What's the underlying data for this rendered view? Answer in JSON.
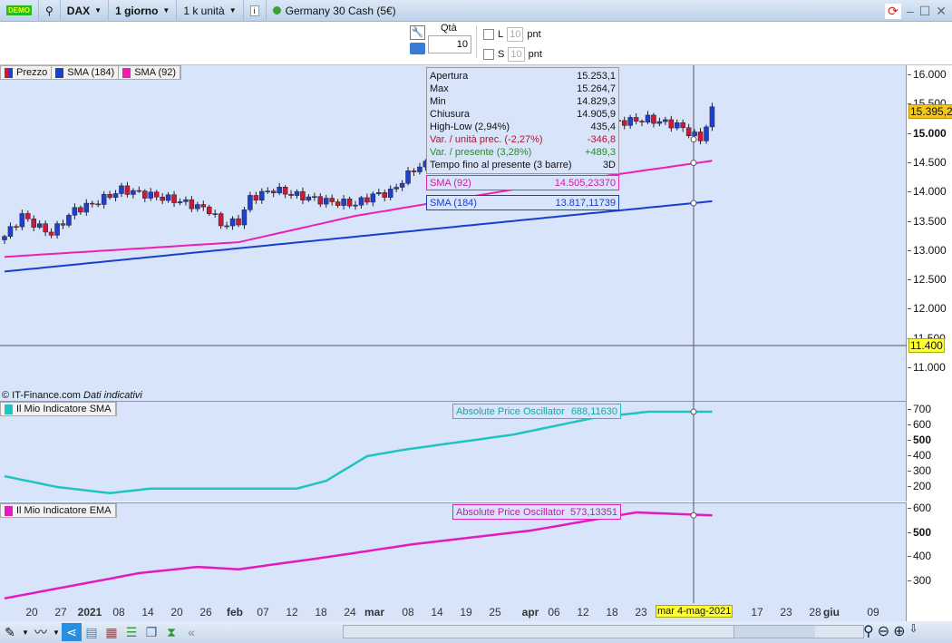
{
  "topbar": {
    "demo_badge": "DEMO",
    "instrument": "DAX",
    "timeframe": "1 giorno",
    "units": "1 k unità",
    "market_name": "Germany 30 Cash (5€)"
  },
  "order": {
    "qty_label": "Qtà",
    "qty_value": "10",
    "long_label": "L",
    "long_value": "10",
    "short_label": "S",
    "short_value": "10",
    "pnt": "pnt"
  },
  "legend": {
    "price": "Prezzo",
    "sma184": "SMA (184)",
    "sma92": "SMA (92)"
  },
  "tooltip": [
    {
      "label": "Apertura",
      "value": "15.253,1",
      "tone": "n"
    },
    {
      "label": "Max",
      "value": "15.264,7",
      "tone": "n"
    },
    {
      "label": "Min",
      "value": "14.829,3",
      "tone": "n"
    },
    {
      "label": "Chiusura",
      "value": "14.905,9",
      "tone": "n"
    },
    {
      "label": "High-Low (2,94%)",
      "value": "435,4",
      "tone": "n"
    },
    {
      "label": "Var. / unità prec. (-2,27%)",
      "value": "-346,8",
      "tone": "red"
    },
    {
      "label": "Var. / presente (3,28%)",
      "value": "+489,3",
      "tone": "green"
    },
    {
      "label": "Tempo fino al presente (3 barre)",
      "value": "3D",
      "tone": "n"
    }
  ],
  "sma92_box": {
    "label": "SMA (92)",
    "value": "14.505,23370"
  },
  "sma184_box": {
    "label": "SMA (184)",
    "value": "13.817,11739"
  },
  "price_axis": {
    "ticks": [
      "16.000",
      "15.500",
      "15.000",
      "14.500",
      "14.000",
      "13.500",
      "13.000",
      "12.500",
      "12.000",
      "11.500",
      "11.000"
    ],
    "last_price": "15.395,2",
    "cursor_price": "11.400"
  },
  "copyright": "© IT-Finance.com",
  "indicative": "Dati indicativi",
  "panel_sma": {
    "legend": "Il Mio Indicatore SMA",
    "box_label": "Absolute Price Oscillator",
    "box_value": "688,11630",
    "ticks": [
      "700",
      "600",
      "500",
      "400",
      "300",
      "200"
    ]
  },
  "panel_ema": {
    "legend": "Il Mio Indicatore EMA",
    "box_label": "Absolute Price Oscillator",
    "box_value": "573,13351",
    "ticks": [
      "600",
      "500",
      "400",
      "300"
    ]
  },
  "xaxis": {
    "labels": [
      "20",
      "27",
      "2021",
      "08",
      "14",
      "20",
      "26",
      "feb",
      "07",
      "12",
      "18",
      "24",
      "mar",
      "08",
      "14",
      "19",
      "25",
      "apr",
      "06",
      "12",
      "18",
      "23",
      "17",
      "23",
      "28",
      "giu",
      "09"
    ],
    "cursor_date": "mar 4-mag-2021"
  },
  "colors": {
    "up": "#1f3fcf",
    "down": "#d0163a",
    "sma184": "#1a3fcc",
    "sma92": "#ee1fb0",
    "osc_sma": "#1fc4c0",
    "osc_ema": "#e21ac0"
  },
  "chart_data": {
    "type": "candlestick",
    "close_keypoints": [
      [
        0,
        13250
      ],
      [
        3,
        13600
      ],
      [
        6,
        13400
      ],
      [
        8,
        13300
      ],
      [
        12,
        13700
      ],
      [
        15,
        13800
      ],
      [
        20,
        14050
      ],
      [
        25,
        13950
      ],
      [
        30,
        13850
      ],
      [
        35,
        13700
      ],
      [
        37,
        13450
      ],
      [
        40,
        13500
      ],
      [
        42,
        13900
      ],
      [
        46,
        14050
      ],
      [
        50,
        13950
      ],
      [
        55,
        13850
      ],
      [
        60,
        13800
      ],
      [
        63,
        13950
      ],
      [
        66,
        14000
      ],
      [
        70,
        14400
      ],
      [
        75,
        14600
      ],
      [
        80,
        14800
      ],
      [
        88,
        15150
      ],
      [
        95,
        15200
      ],
      [
        105,
        15200
      ],
      [
        110,
        15250
      ],
      [
        115,
        15150
      ],
      [
        119,
        14906
      ],
      [
        120,
        15150
      ],
      [
        121,
        15395
      ]
    ],
    "sma184": [
      [
        0,
        12650
      ],
      [
        121,
        13850
      ]
    ],
    "sma92": [
      [
        0,
        12900
      ],
      [
        40,
        13150
      ],
      [
        60,
        13600
      ],
      [
        90,
        14100
      ],
      [
        121,
        14540
      ]
    ],
    "osc_sma": [
      [
        0,
        270
      ],
      [
        9,
        200
      ],
      [
        18,
        160
      ],
      [
        25,
        190
      ],
      [
        50,
        190
      ],
      [
        55,
        240
      ],
      [
        62,
        400
      ],
      [
        68,
        440
      ],
      [
        87,
        540
      ],
      [
        101,
        650
      ],
      [
        110,
        688
      ],
      [
        121,
        688
      ]
    ],
    "osc_ema": [
      [
        0,
        230
      ],
      [
        23,
        334
      ],
      [
        33,
        360
      ],
      [
        40,
        350
      ],
      [
        55,
        400
      ],
      [
        70,
        454
      ],
      [
        90,
        510
      ],
      [
        108,
        585
      ],
      [
        121,
        573
      ]
    ]
  }
}
